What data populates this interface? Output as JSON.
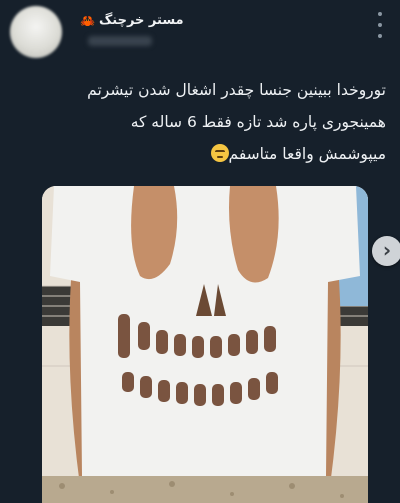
{
  "author": {
    "display_name": "مستر خرچنگ",
    "badge_icon": "crab-icon",
    "avatar_icon": "avatar"
  },
  "tweet": {
    "line1": "توروخدا ببینین جنسا چقدر اشغال شدن تیشرتم",
    "line2": "همینجوری پاره شد تازه فقط 6 ساله که",
    "line3": "میپوشمش واقعا متاسفم",
    "emoji": "unamused-face-emoji"
  },
  "media": {
    "photo_subject": "white-tshirt-skull-cutout",
    "next_icon": "chevron-right-icon",
    "next_label": "›"
  },
  "colors": {
    "background": "#16202b",
    "text": "#eef1f4",
    "shirt": "#f2f2f0"
  }
}
